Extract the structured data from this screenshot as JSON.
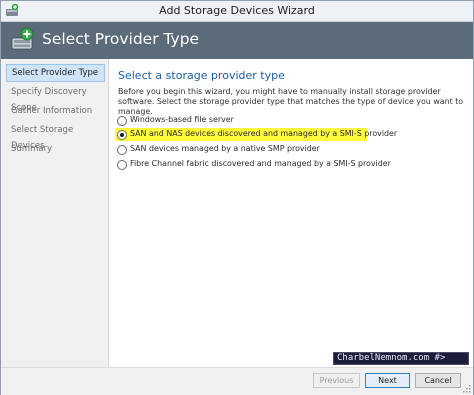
{
  "window": {
    "title": "Add Storage Devices Wizard"
  },
  "banner": {
    "title": "Select Provider Type",
    "icon": "add-storage-icon"
  },
  "nav": {
    "items": [
      {
        "label": "Select Provider Type",
        "selected": true
      },
      {
        "label": "Specify Discovery Scope",
        "selected": false
      },
      {
        "label": "Gather Information",
        "selected": false
      },
      {
        "label": "Select Storage Devices",
        "selected": false
      },
      {
        "label": "Summary",
        "selected": false
      }
    ]
  },
  "content": {
    "heading": "Select a storage provider type",
    "intro": "Before you begin this wizard, you might have to manually install storage provider software. Select the storage provider type that matches the type of device you want to manage.",
    "options": [
      {
        "label": "Windows-based file server",
        "checked": false,
        "highlighted": false
      },
      {
        "label": "SAN and NAS devices discovered and managed by a SMI-S provider",
        "checked": true,
        "highlighted": true
      },
      {
        "label": "SAN devices managed by a native SMP provider",
        "checked": false,
        "highlighted": false
      },
      {
        "label": "Fibre Channel fabric discovered and managed by a SMI-S provider",
        "checked": false,
        "highlighted": false
      }
    ],
    "highlight_color": "#fffa3c"
  },
  "watermark": {
    "text": "CharbelNemnom.com #>"
  },
  "footer": {
    "previous_label": "Previous",
    "next_label": "Next",
    "cancel_label": "Cancel"
  }
}
